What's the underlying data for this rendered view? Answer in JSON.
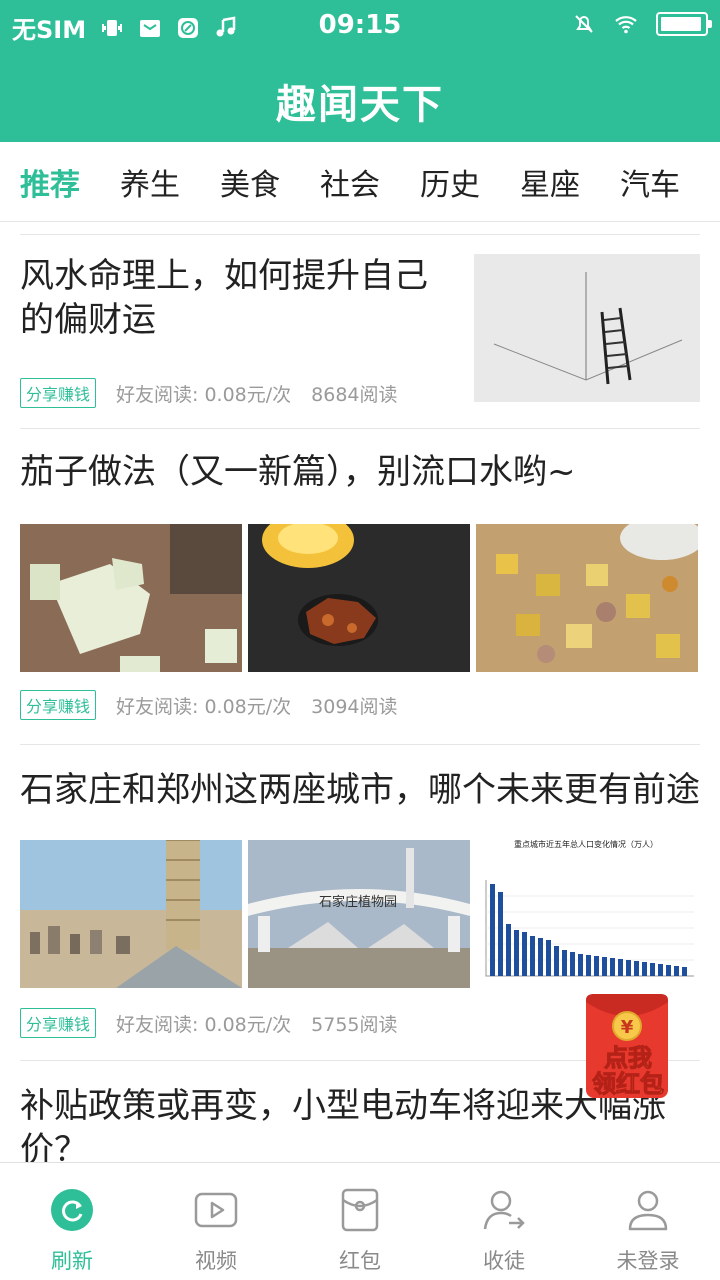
{
  "status_bar": {
    "carrier": "无SIM",
    "time": "09:15",
    "icons": [
      "vibrate-icon",
      "mail-icon",
      "browser-icon",
      "music-icon",
      "mute-alarm-icon",
      "wifi-icon",
      "battery-icon"
    ]
  },
  "app": {
    "title": "趣闻天下",
    "accent": "#2fbf98"
  },
  "tabs": [
    {
      "label": "推荐",
      "active": true
    },
    {
      "label": "养生"
    },
    {
      "label": "美食"
    },
    {
      "label": "社会"
    },
    {
      "label": "历史"
    },
    {
      "label": "星座"
    },
    {
      "label": "汽车"
    }
  ],
  "articles": [
    {
      "title": "风水命理上，如何提升自己的偏财运",
      "tag": "分享赚钱",
      "reward": "好友阅读: 0.08元/次",
      "reads": "8684阅读"
    },
    {
      "title": "茄子做法（又一新篇），别流口水哟~",
      "tag": "分享赚钱",
      "reward": "好友阅读: 0.08元/次",
      "reads": "3094阅读"
    },
    {
      "title": "石家庄和郑州这两座城市，哪个未来更有前途",
      "tag": "分享赚钱",
      "reward": "好友阅读: 0.08元/次",
      "reads": "5755阅读",
      "images": {
        "gate_sign": "石家庄植物园",
        "chart_title": "重点城市近五年总人口变化情况（万人）"
      }
    },
    {
      "title": "补贴政策或再变，小型电动车将迎来大幅涨价？"
    }
  ],
  "red_packet": {
    "line1": "点我",
    "line2": "领红包",
    "symbol": "¥"
  },
  "bottom_nav": [
    {
      "label": "刷新",
      "icon": "refresh-icon",
      "active": true
    },
    {
      "label": "视频",
      "icon": "video-icon"
    },
    {
      "label": "红包",
      "icon": "red-packet-icon"
    },
    {
      "label": "收徒",
      "icon": "add-follower-icon"
    },
    {
      "label": "未登录",
      "icon": "user-icon"
    }
  ]
}
